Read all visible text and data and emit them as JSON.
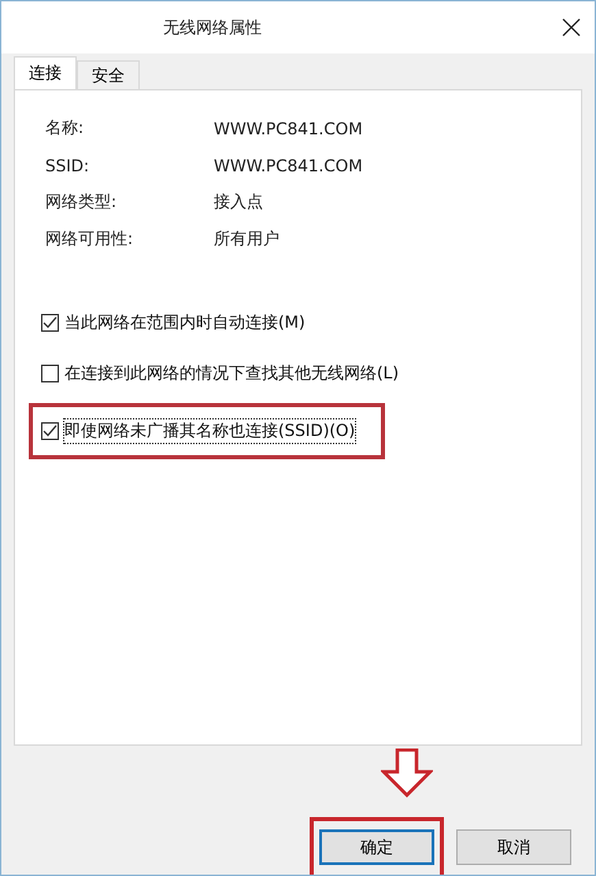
{
  "window": {
    "title": "无线网络属性"
  },
  "tabs": [
    {
      "label": "连接",
      "selected": true
    },
    {
      "label": "安全",
      "selected": false
    }
  ],
  "properties": [
    {
      "label": "名称:",
      "value": "WWW.PC841.COM"
    },
    {
      "label": "SSID:",
      "value": "WWW.PC841.COM"
    },
    {
      "label": "网络类型:",
      "value": "接入点"
    },
    {
      "label": "网络可用性:",
      "value": "所有用户"
    }
  ],
  "options": [
    {
      "label": "当此网络在范围内时自动连接(M)",
      "checked": true,
      "highlighted": false,
      "focused": false
    },
    {
      "label": "在连接到此网络的情况下查找其他无线网络(L)",
      "checked": false,
      "highlighted": false,
      "focused": false
    },
    {
      "label": "即使网络未广播其名称也连接(SSID)(O)",
      "checked": true,
      "highlighted": true,
      "focused": true
    }
  ],
  "buttons": [
    {
      "label": "确定",
      "default": true,
      "highlighted": true
    },
    {
      "label": "取消",
      "default": false,
      "highlighted": false
    }
  ]
}
